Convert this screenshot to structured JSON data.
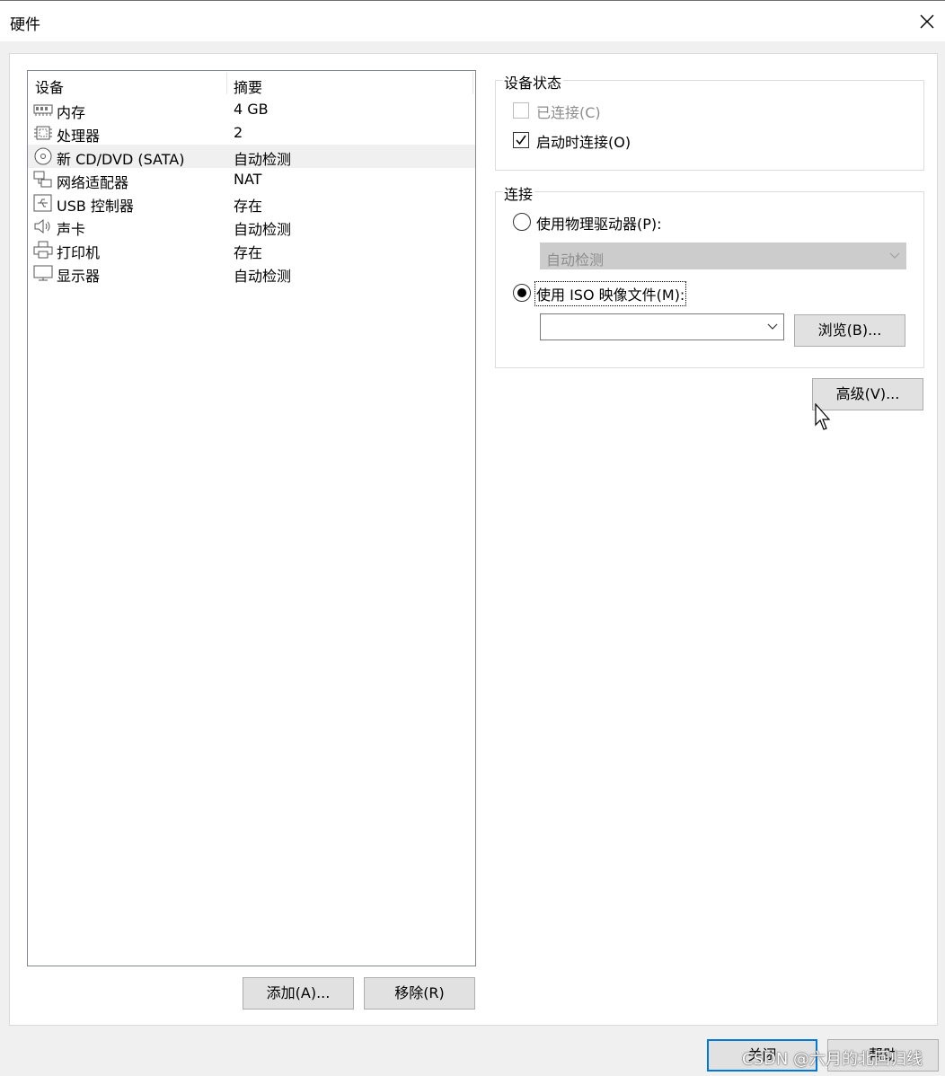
{
  "window": {
    "title": "硬件"
  },
  "device_list": {
    "columns": {
      "device": "设备",
      "summary": "摘要"
    },
    "rows": [
      {
        "icon": "memory-icon",
        "name": "内存",
        "summary": "4 GB",
        "selected": false
      },
      {
        "icon": "processor-icon",
        "name": "处理器",
        "summary": "2",
        "selected": false
      },
      {
        "icon": "cd-dvd-icon",
        "name": "新 CD/DVD (SATA)",
        "summary": "自动检测",
        "selected": true
      },
      {
        "icon": "network-adapter-icon",
        "name": "网络适配器",
        "summary": "NAT",
        "selected": false
      },
      {
        "icon": "usb-icon",
        "name": "USB 控制器",
        "summary": "存在",
        "selected": false
      },
      {
        "icon": "sound-card-icon",
        "name": "声卡",
        "summary": "自动检测",
        "selected": false
      },
      {
        "icon": "printer-icon",
        "name": "打印机",
        "summary": "存在",
        "selected": false
      },
      {
        "icon": "display-icon",
        "name": "显示器",
        "summary": "自动检测",
        "selected": false
      }
    ],
    "add_label": "添加(A)...",
    "remove_label": "移除(R)"
  },
  "device_status": {
    "legend": "设备状态",
    "connected_label": "已连接(C)",
    "connected_checked": false,
    "connected_enabled": false,
    "connect_at_power_on_label": "启动时连接(O)",
    "connect_at_power_on_checked": true
  },
  "connection": {
    "legend": "连接",
    "physical_drive_label": "使用物理驱动器(P):",
    "physical_drive_value": "自动检测",
    "iso_label": "使用 ISO 映像文件(M):",
    "iso_value": "",
    "selected_option": "iso",
    "browse_label": "浏览(B)..."
  },
  "advanced_label": "高级(V)...",
  "footer": {
    "close_label": "关闭",
    "help_label": "帮助"
  },
  "watermark": "CSDN @六月的北回归线",
  "colors": {
    "focus_border": "#0078d7",
    "button_bg": "#e1e1e1",
    "dialog_bg": "#f0f0f0"
  }
}
